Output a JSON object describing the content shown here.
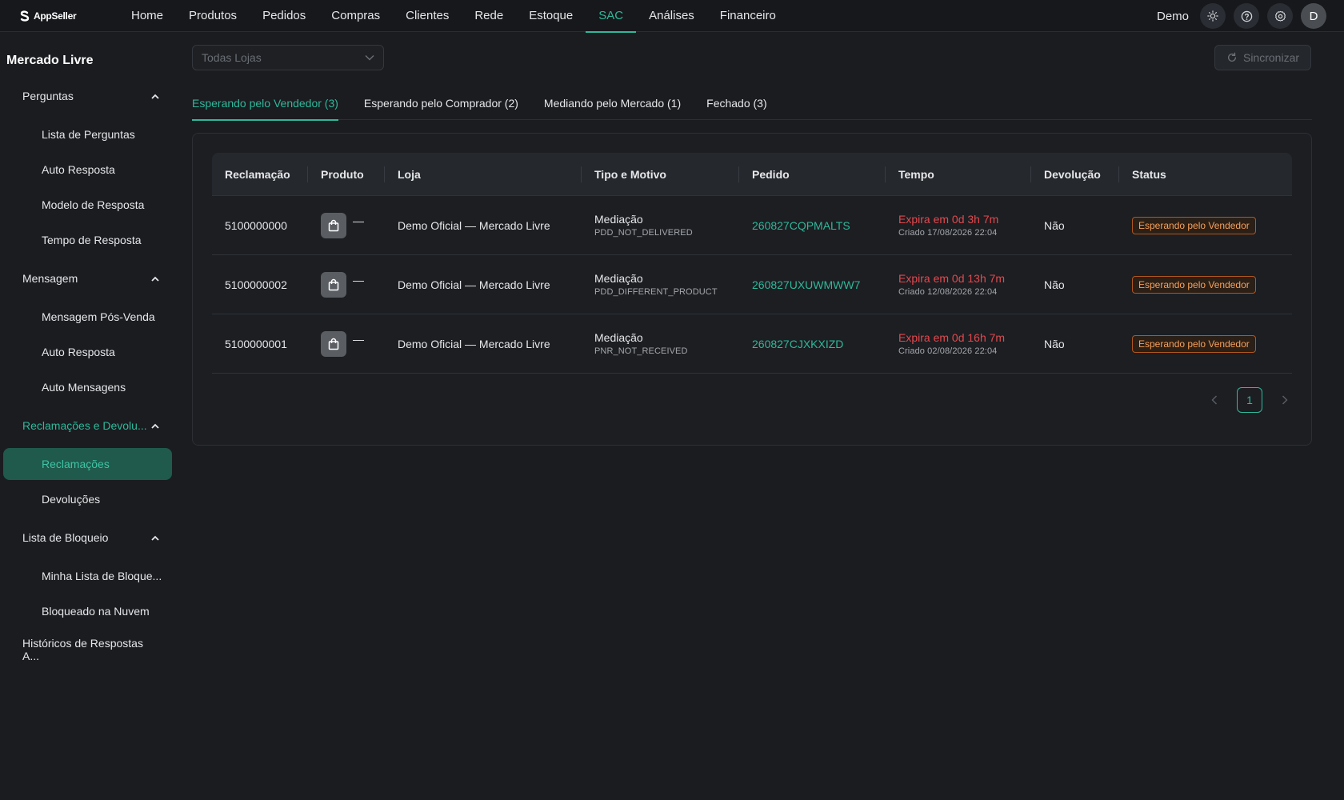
{
  "app": {
    "logo_text": "AppSeller"
  },
  "nav": {
    "items": [
      {
        "label": "Home"
      },
      {
        "label": "Produtos"
      },
      {
        "label": "Pedidos"
      },
      {
        "label": "Compras"
      },
      {
        "label": "Clientes"
      },
      {
        "label": "Rede"
      },
      {
        "label": "Estoque"
      },
      {
        "label": "SAC"
      },
      {
        "label": "Análises"
      },
      {
        "label": "Financeiro"
      }
    ],
    "active": "SAC",
    "user_name": "Demo",
    "avatar_initial": "D",
    "icons": [
      "sun-icon",
      "help-icon",
      "gear-icon"
    ]
  },
  "sidebar": {
    "title": "Mercado Livre",
    "groups": [
      {
        "label": "Perguntas",
        "items": [
          "Lista de Perguntas",
          "Auto Resposta",
          "Modelo de Resposta",
          "Tempo de Resposta"
        ]
      },
      {
        "label": "Mensagem",
        "items": [
          "Mensagem Pós-Venda",
          "Auto Resposta",
          "Auto Mensagens"
        ]
      },
      {
        "label": "Reclamações e Devolu...",
        "items": [
          "Reclamações",
          "Devoluções"
        ]
      },
      {
        "label": "Lista de Bloqueio",
        "items": [
          "Minha Lista de Bloque...",
          "Bloqueado na Nuvem"
        ]
      }
    ],
    "bottom_item": "Históricos de Respostas A...",
    "selected_item": "Reclamações"
  },
  "filters": {
    "store_select": "Todas Lojas",
    "sync_label": "Sincronizar"
  },
  "tabs": [
    {
      "label": "Esperando pelo Vendedor (3)",
      "active": true
    },
    {
      "label": "Esperando pelo Comprador (2)",
      "active": false
    },
    {
      "label": "Mediando pelo Mercado (1)",
      "active": false
    },
    {
      "label": "Fechado (3)",
      "active": false
    }
  ],
  "table": {
    "columns": [
      "Reclamação",
      "Produto",
      "Loja",
      "Tipo e Motivo",
      "Pedido",
      "Tempo",
      "Devolução",
      "Status"
    ],
    "rows": [
      {
        "claim": "5100000000",
        "product": "—",
        "store": "Demo Oficial — Mercado Livre",
        "type": "Mediação",
        "reason": "PDD_NOT_DELIVERED",
        "order": "260827CQPMALTS",
        "expires": "Expira em 0d 3h 7m",
        "created": "Criado 17/08/2026 22:04",
        "return": "Não",
        "status": "Esperando pelo Vendedor"
      },
      {
        "claim": "5100000002",
        "product": "—",
        "store": "Demo Oficial — Mercado Livre",
        "type": "Mediação",
        "reason": "PDD_DIFFERENT_PRODUCT",
        "order": "260827UXUWMWW7",
        "expires": "Expira em 0d 13h 7m",
        "created": "Criado 12/08/2026 22:04",
        "return": "Não",
        "status": "Esperando pelo Vendedor"
      },
      {
        "claim": "5100000001",
        "product": "—",
        "store": "Demo Oficial — Mercado Livre",
        "type": "Mediação",
        "reason": "PNR_NOT_RECEIVED",
        "order": "260827CJXKXIZD",
        "expires": "Expira em 0d 16h 7m",
        "created": "Criado 02/08/2026 22:04",
        "return": "Não",
        "status": "Esperando pelo Vendedor"
      }
    ]
  },
  "pagination": {
    "current": "1"
  },
  "colors": {
    "accent": "#2fb89a",
    "danger": "#e5484d",
    "warning": "#f5a05a",
    "background": "#1a1c20"
  }
}
